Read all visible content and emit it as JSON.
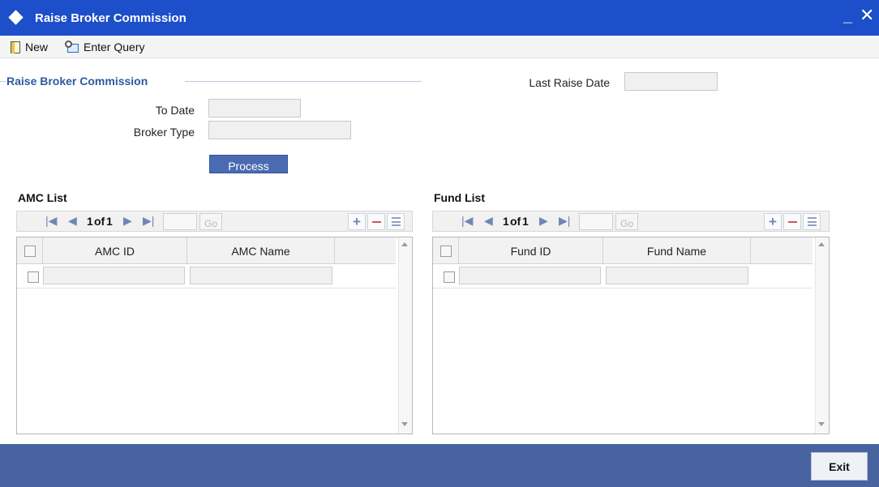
{
  "window": {
    "title": "Raise Broker Commission",
    "minimize_glyph": "_",
    "close_glyph": "✕"
  },
  "toolbar": {
    "new_label": "New",
    "enter_query_label": "Enter Query"
  },
  "form": {
    "section_title": "Raise Broker Commission",
    "last_raise_date_label": "Last Raise Date",
    "last_raise_date_value": "",
    "to_date_label": "To Date",
    "to_date_value": "",
    "broker_type_label": "Broker Type",
    "broker_type_value": "",
    "process_label": "Process"
  },
  "amc_list": {
    "title": "AMC List",
    "page_current": "1",
    "page_of": "of",
    "page_total": "1",
    "go_label": "Go",
    "columns": [
      "AMC ID",
      "AMC Name"
    ],
    "rows": [
      {
        "amc_id": "",
        "amc_name": ""
      }
    ]
  },
  "fund_list": {
    "title": "Fund List",
    "page_current": "1",
    "page_of": "of",
    "page_total": "1",
    "go_label": "Go",
    "columns": [
      "Fund ID",
      "Fund Name"
    ],
    "rows": [
      {
        "fund_id": "",
        "fund_name": ""
      }
    ]
  },
  "footer": {
    "exit_label": "Exit"
  },
  "icons": {
    "first_page": "first-page-icon",
    "prev_page": "previous-page-icon",
    "next_page": "next-page-icon",
    "last_page": "last-page-icon",
    "add_row": "plus-icon",
    "delete_row": "minus-icon",
    "single_view": "list-icon"
  },
  "colors": {
    "titlebar": "#1c4fc9",
    "footer": "#4863a0",
    "section_title": "#2c5aa0",
    "process_button": "#4a6bb1"
  }
}
